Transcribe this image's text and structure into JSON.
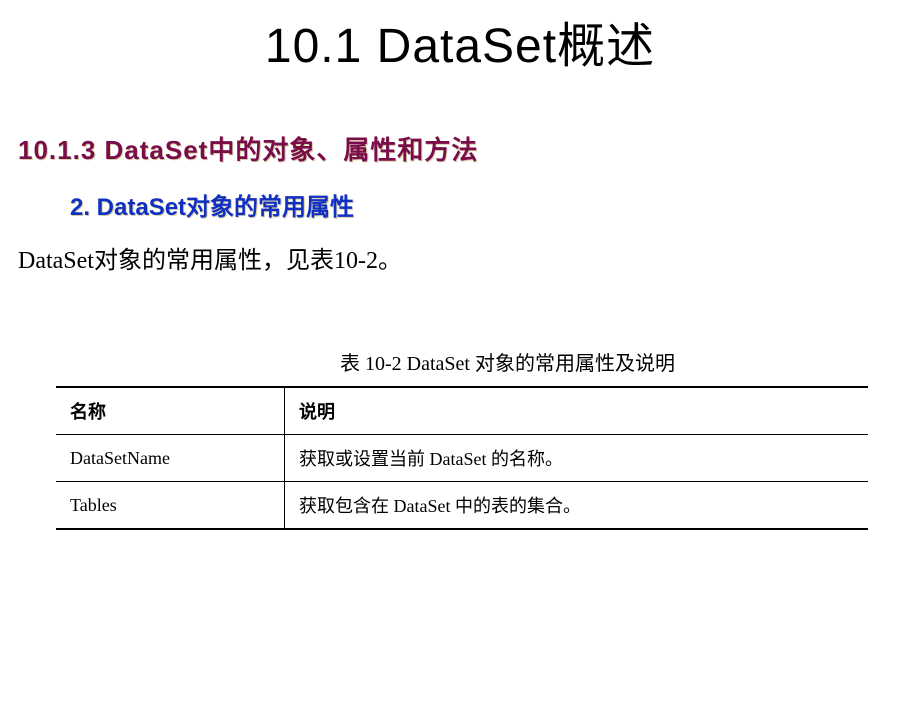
{
  "title": "10.1  DataSet概述",
  "section_heading": "10.1.3  DataSet中的对象、属性和方法",
  "subsection_heading": "2. DataSet对象的常用属性",
  "body_text": "DataSet对象的常用属性，见表10-2。",
  "table": {
    "caption": "表 10-2    DataSet 对象的常用属性及说明",
    "headers": [
      "名称",
      "说明"
    ],
    "rows": [
      {
        "name": "DataSetName",
        "desc": "获取或设置当前 DataSet 的名称。"
      },
      {
        "name": "Tables",
        "desc": "获取包含在 DataSet 中的表的集合。"
      }
    ]
  }
}
